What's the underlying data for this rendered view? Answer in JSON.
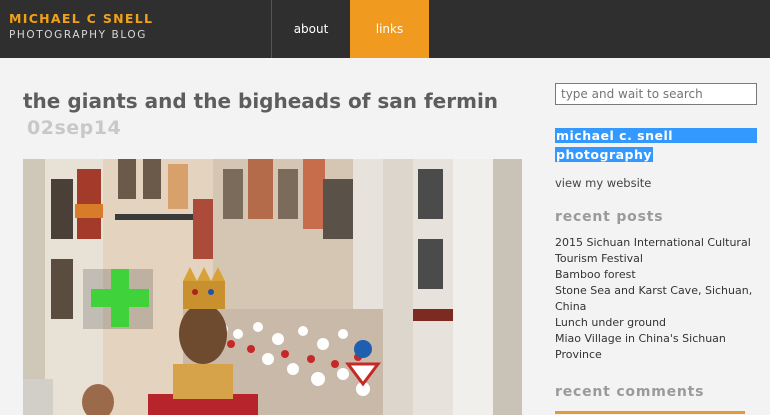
{
  "header": {
    "brand_line1_a": "MICHAEL",
    "brand_line1_c": "C",
    "brand_line1_b": "SNELL",
    "brand_line2": "PHOTOGRAPHY BLOG",
    "nav": [
      {
        "label": "about",
        "active": false
      },
      {
        "label": "links",
        "active": true
      }
    ],
    "colors": {
      "bar": "#2f2f2f",
      "accent": "#f09a1f"
    }
  },
  "post": {
    "title": "the giants and the bigheads of san fermin",
    "date": "02sep14",
    "image_icon": "street-festival-photo"
  },
  "sidebar": {
    "search_placeholder": "type and wait to search",
    "selected_heading_1": "michael c. snell",
    "selected_heading_2": "photography",
    "view_site": "view my website",
    "recent_posts_title": "recent posts",
    "recent_posts": [
      "2015 Sichuan International Cultural Tourism Festival",
      "Bamboo forest",
      "Stone Sea and Karst Cave, Sichuan, China",
      "Lunch under ground",
      "Miao Village in China's Sichuan Province"
    ],
    "recent_comments_title": "recent comments",
    "selection_color": "#3399ff"
  }
}
